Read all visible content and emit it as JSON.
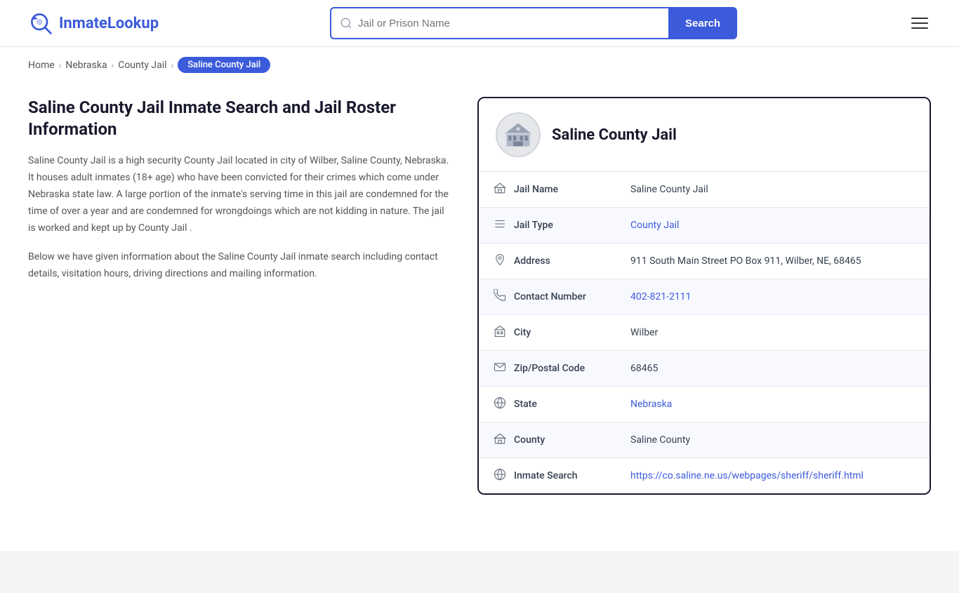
{
  "header": {
    "logo_text_part1": "Inmate",
    "logo_text_part2": "Lookup",
    "search_placeholder": "Jail or Prison Name",
    "search_button_label": "Search"
  },
  "breadcrumb": {
    "home": "Home",
    "level2": "Nebraska",
    "level3": "County Jail",
    "active": "Saline County Jail"
  },
  "left": {
    "heading": "Saline County Jail Inmate Search and Jail Roster Information",
    "desc1": "Saline County Jail is a high security County Jail located in city of Wilber, Saline County, Nebraska. It houses adult inmates (18+ age) who have been convicted for their crimes which come under Nebraska state law. A large portion of the inmate's serving time in this jail are condemned for the time of over a year and are condemned for wrongdoings which are not kidding in nature. The jail is worked and kept up by County Jail .",
    "desc2": "Below we have given information about the Saline County Jail inmate search including contact details, visitation hours, driving directions and mailing information."
  },
  "card": {
    "title": "Saline County Jail",
    "rows": [
      {
        "icon": "🏛",
        "label": "Jail Name",
        "value": "Saline County Jail",
        "link": null
      },
      {
        "icon": "☰",
        "label": "Jail Type",
        "value": "County Jail",
        "link": "#"
      },
      {
        "icon": "📍",
        "label": "Address",
        "value": "911 South Main Street PO Box 911, Wilber, NE, 68465",
        "link": null
      },
      {
        "icon": "📞",
        "label": "Contact Number",
        "value": "402-821-2111",
        "link": "tel:402-821-2111"
      },
      {
        "icon": "🏙",
        "label": "City",
        "value": "Wilber",
        "link": null
      },
      {
        "icon": "✉",
        "label": "Zip/Postal Code",
        "value": "68465",
        "link": null
      },
      {
        "icon": "🌐",
        "label": "State",
        "value": "Nebraska",
        "link": "#"
      },
      {
        "icon": "🏛",
        "label": "County",
        "value": "Saline County",
        "link": null
      },
      {
        "icon": "🌐",
        "label": "Inmate Search",
        "value": "https://co.saline.ne.us/webpages/sheriff/sheriff.html",
        "link": "https://co.saline.ne.us/webpages/sheriff/sheriff.html"
      }
    ]
  }
}
